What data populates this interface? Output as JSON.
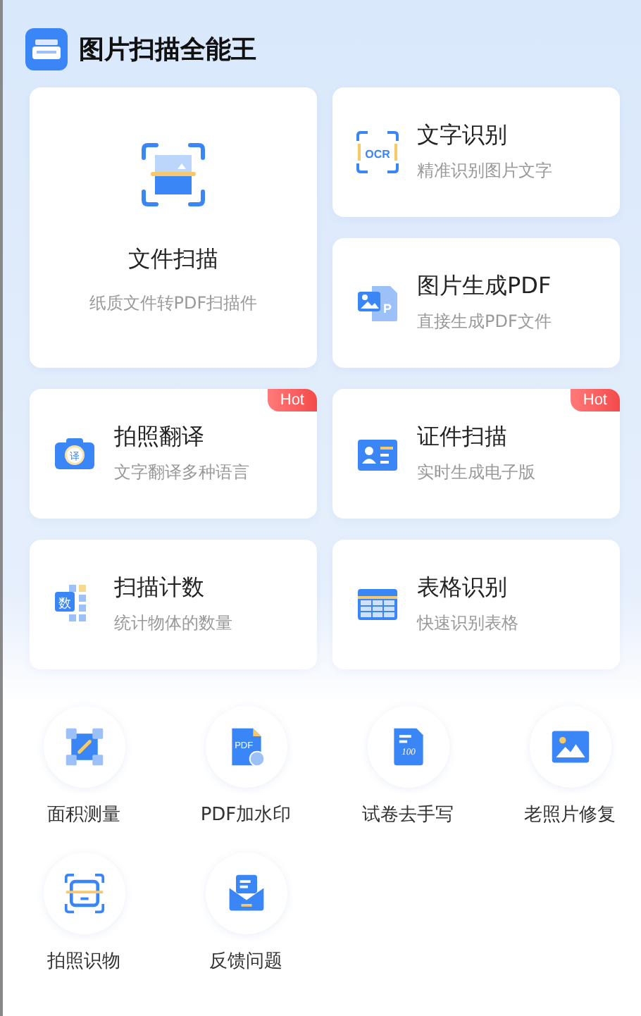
{
  "app": {
    "title": "图片扫描全能王"
  },
  "tiles": [
    {
      "kind": "large",
      "title": "文件扫描",
      "subtitle": "纸质文件转PDF扫描件"
    },
    {
      "kind": "small",
      "title": "文字识别",
      "subtitle": "精准识别图片文字",
      "icon_text": "OCR"
    },
    {
      "kind": "small",
      "title": "图片生成PDF",
      "subtitle": "直接生成PDF文件",
      "icon_text": "P"
    },
    {
      "kind": "small",
      "title": "拍照翻译",
      "subtitle": "文字翻译多种语言",
      "icon_text": "译",
      "badge": "Hot"
    },
    {
      "kind": "small",
      "title": "证件扫描",
      "subtitle": "实时生成电子版",
      "badge": "Hot"
    },
    {
      "kind": "small",
      "title": "扫描计数",
      "subtitle": "统计物体的数量",
      "icon_text": "数"
    },
    {
      "kind": "small",
      "title": "表格识别",
      "subtitle": "快速识别表格"
    }
  ],
  "tools": [
    {
      "label": "面积测量"
    },
    {
      "label": "PDF加水印",
      "icon_text": "PDF"
    },
    {
      "label": "试卷去手写",
      "icon_text": "100"
    },
    {
      "label": "老照片修复"
    },
    {
      "label": "拍照识物"
    },
    {
      "label": "反馈问题"
    }
  ]
}
